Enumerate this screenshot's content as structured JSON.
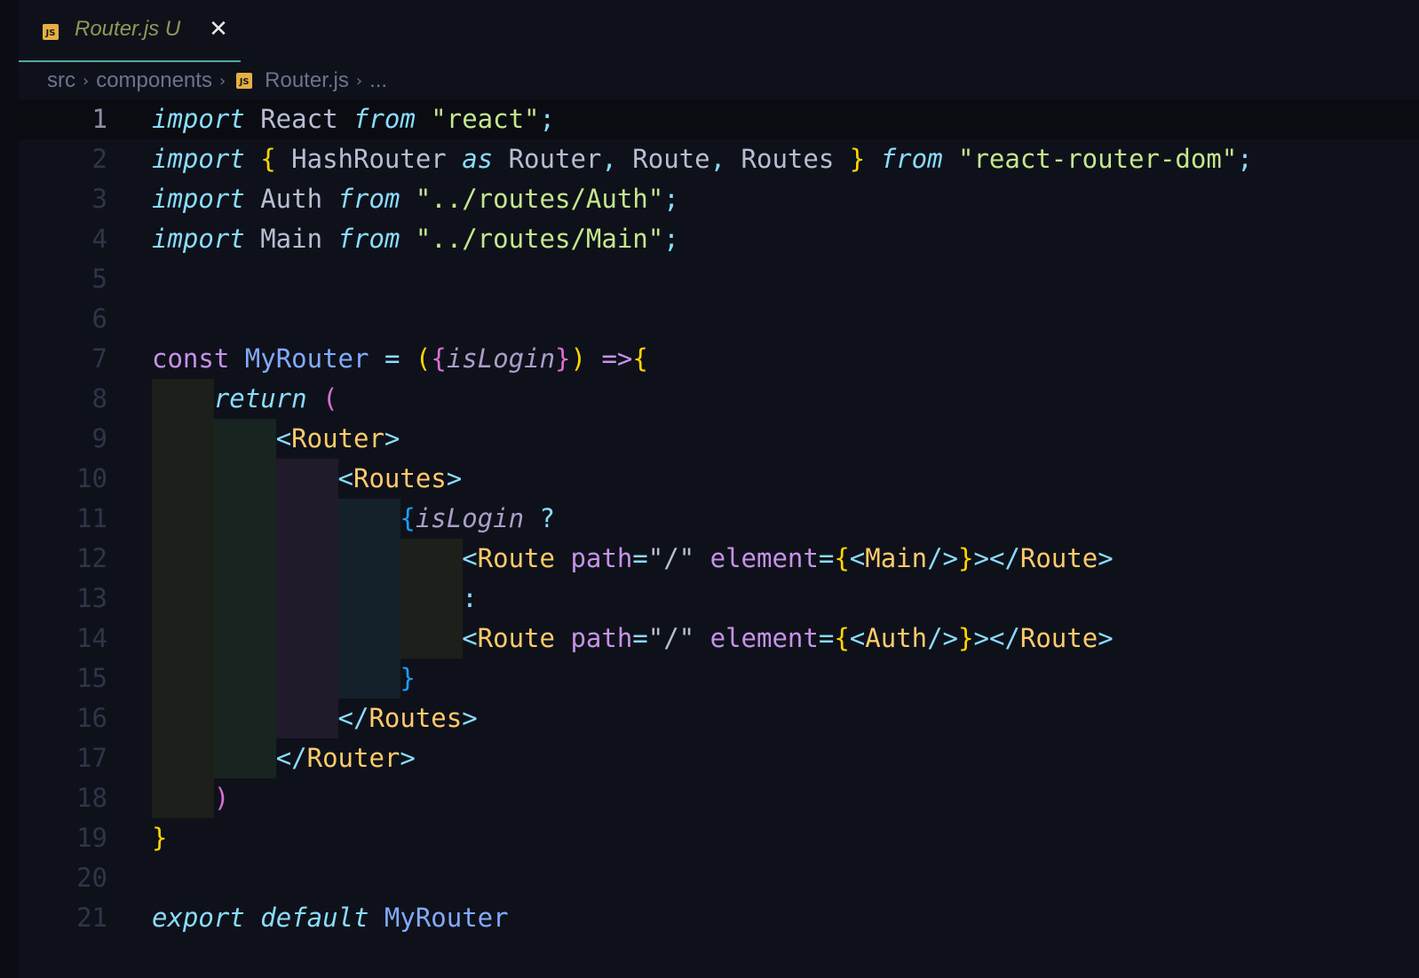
{
  "tab": {
    "icon": "js-file-icon",
    "badge": "JS",
    "title": "Router.js",
    "status": "U",
    "close": "✕"
  },
  "breadcrumb": {
    "items": [
      "src",
      "components",
      "Router.js",
      "..."
    ],
    "separator": "›"
  },
  "active_line": 1,
  "colors": {
    "background": "#0f111a",
    "tab_underline": "#4fa8a0",
    "keyword": "#89ddff",
    "string": "#c3e88d",
    "jsx_tag": "#ffcb6b",
    "attribute": "#c792ea"
  },
  "code_lines": [
    {
      "n": "1",
      "tokens": [
        {
          "t": "import",
          "c": "k-it"
        },
        {
          "t": " React ",
          "c": "ident"
        },
        {
          "t": "from",
          "c": "k-it"
        },
        {
          "t": " ",
          "c": ""
        },
        {
          "t": "\"react\"",
          "c": "str"
        },
        {
          "t": ";",
          "c": "punc"
        }
      ]
    },
    {
      "n": "2",
      "tokens": [
        {
          "t": "import",
          "c": "k-it"
        },
        {
          "t": " ",
          "c": ""
        },
        {
          "t": "{",
          "c": "brace-y"
        },
        {
          "t": " HashRouter ",
          "c": "ident"
        },
        {
          "t": "as",
          "c": "k-it"
        },
        {
          "t": " Router",
          "c": "ident"
        },
        {
          "t": ",",
          "c": "punc"
        },
        {
          "t": " Route",
          "c": "ident"
        },
        {
          "t": ",",
          "c": "punc"
        },
        {
          "t": " Routes ",
          "c": "ident"
        },
        {
          "t": "}",
          "c": "brace-y"
        },
        {
          "t": " ",
          "c": ""
        },
        {
          "t": "from",
          "c": "k-it"
        },
        {
          "t": " ",
          "c": ""
        },
        {
          "t": "\"react-router-dom\"",
          "c": "str"
        },
        {
          "t": ";",
          "c": "punc"
        }
      ]
    },
    {
      "n": "3",
      "tokens": [
        {
          "t": "import",
          "c": "k-it"
        },
        {
          "t": " Auth ",
          "c": "ident"
        },
        {
          "t": "from",
          "c": "k-it"
        },
        {
          "t": " ",
          "c": ""
        },
        {
          "t": "\"../routes/Auth\"",
          "c": "str"
        },
        {
          "t": ";",
          "c": "punc"
        }
      ]
    },
    {
      "n": "4",
      "tokens": [
        {
          "t": "import",
          "c": "k-it"
        },
        {
          "t": " Main ",
          "c": "ident"
        },
        {
          "t": "from",
          "c": "k-it"
        },
        {
          "t": " ",
          "c": ""
        },
        {
          "t": "\"../routes/Main\"",
          "c": "str"
        },
        {
          "t": ";",
          "c": "punc"
        }
      ]
    },
    {
      "n": "5",
      "tokens": []
    },
    {
      "n": "6",
      "tokens": []
    },
    {
      "n": "7",
      "tokens": [
        {
          "t": "const",
          "c": "k-purple"
        },
        {
          "t": " ",
          "c": ""
        },
        {
          "t": "MyRouter",
          "c": "fn"
        },
        {
          "t": " ",
          "c": ""
        },
        {
          "t": "=",
          "c": "punc"
        },
        {
          "t": " ",
          "c": ""
        },
        {
          "t": "(",
          "c": "brace-y"
        },
        {
          "t": "{",
          "c": "brace-p"
        },
        {
          "t": "isLogin",
          "c": "param"
        },
        {
          "t": "}",
          "c": "brace-p"
        },
        {
          "t": ")",
          "c": "brace-y"
        },
        {
          "t": " ",
          "c": ""
        },
        {
          "t": "=>",
          "c": "k-purple"
        },
        {
          "t": "{",
          "c": "brace-y"
        }
      ]
    },
    {
      "n": "8",
      "tokens": [
        {
          "t": "    ",
          "c": ""
        },
        {
          "t": "return",
          "c": "k-it"
        },
        {
          "t": " ",
          "c": ""
        },
        {
          "t": "(",
          "c": "brace-p"
        }
      ]
    },
    {
      "n": "9",
      "tokens": [
        {
          "t": "        ",
          "c": ""
        },
        {
          "t": "<",
          "c": "punc"
        },
        {
          "t": "Router",
          "c": "tag"
        },
        {
          "t": ">",
          "c": "punc"
        }
      ]
    },
    {
      "n": "10",
      "tokens": [
        {
          "t": "            ",
          "c": ""
        },
        {
          "t": "<",
          "c": "punc"
        },
        {
          "t": "Routes",
          "c": "tag"
        },
        {
          "t": ">",
          "c": "punc"
        }
      ]
    },
    {
      "n": "11",
      "tokens": [
        {
          "t": "                ",
          "c": ""
        },
        {
          "t": "{",
          "c": "brace-b"
        },
        {
          "t": "isLogin",
          "c": "param"
        },
        {
          "t": " ",
          "c": ""
        },
        {
          "t": "?",
          "c": "punc"
        }
      ]
    },
    {
      "n": "12",
      "tokens": [
        {
          "t": "                    ",
          "c": ""
        },
        {
          "t": "<",
          "c": "punc"
        },
        {
          "t": "Route",
          "c": "tag"
        },
        {
          "t": " ",
          "c": ""
        },
        {
          "t": "path",
          "c": "attr"
        },
        {
          "t": "=",
          "c": "punc"
        },
        {
          "t": "\"/\"",
          "c": "ident"
        },
        {
          "t": " ",
          "c": ""
        },
        {
          "t": "element",
          "c": "attr"
        },
        {
          "t": "=",
          "c": "punc"
        },
        {
          "t": "{",
          "c": "brace-y"
        },
        {
          "t": "<",
          "c": "punc"
        },
        {
          "t": "Main",
          "c": "tag"
        },
        {
          "t": "/>",
          "c": "punc"
        },
        {
          "t": "}",
          "c": "brace-y"
        },
        {
          "t": "></",
          "c": "punc"
        },
        {
          "t": "Route",
          "c": "tag"
        },
        {
          "t": ">",
          "c": "punc"
        }
      ]
    },
    {
      "n": "13",
      "tokens": [
        {
          "t": "                    ",
          "c": ""
        },
        {
          "t": ":",
          "c": "punc"
        }
      ]
    },
    {
      "n": "14",
      "tokens": [
        {
          "t": "                    ",
          "c": ""
        },
        {
          "t": "<",
          "c": "punc"
        },
        {
          "t": "Route",
          "c": "tag"
        },
        {
          "t": " ",
          "c": ""
        },
        {
          "t": "path",
          "c": "attr"
        },
        {
          "t": "=",
          "c": "punc"
        },
        {
          "t": "\"/\"",
          "c": "ident"
        },
        {
          "t": " ",
          "c": ""
        },
        {
          "t": "element",
          "c": "attr"
        },
        {
          "t": "=",
          "c": "punc"
        },
        {
          "t": "{",
          "c": "brace-y"
        },
        {
          "t": "<",
          "c": "punc"
        },
        {
          "t": "Auth",
          "c": "tag"
        },
        {
          "t": "/>",
          "c": "punc"
        },
        {
          "t": "}",
          "c": "brace-y"
        },
        {
          "t": "></",
          "c": "punc"
        },
        {
          "t": "Route",
          "c": "tag"
        },
        {
          "t": ">",
          "c": "punc"
        }
      ]
    },
    {
      "n": "15",
      "tokens": [
        {
          "t": "                ",
          "c": ""
        },
        {
          "t": "}",
          "c": "brace-b"
        }
      ]
    },
    {
      "n": "16",
      "tokens": [
        {
          "t": "            ",
          "c": ""
        },
        {
          "t": "</",
          "c": "punc"
        },
        {
          "t": "Routes",
          "c": "tag"
        },
        {
          "t": ">",
          "c": "punc"
        }
      ]
    },
    {
      "n": "17",
      "tokens": [
        {
          "t": "        ",
          "c": ""
        },
        {
          "t": "</",
          "c": "punc"
        },
        {
          "t": "Router",
          "c": "tag"
        },
        {
          "t": ">",
          "c": "punc"
        }
      ]
    },
    {
      "n": "18",
      "tokens": [
        {
          "t": "    ",
          "c": ""
        },
        {
          "t": ")",
          "c": "brace-p"
        }
      ]
    },
    {
      "n": "19",
      "tokens": [
        {
          "t": "}",
          "c": "brace-y"
        }
      ]
    },
    {
      "n": "20",
      "tokens": []
    },
    {
      "n": "21",
      "tokens": [
        {
          "t": "export",
          "c": "k-it"
        },
        {
          "t": " ",
          "c": ""
        },
        {
          "t": "default",
          "c": "k-it"
        },
        {
          "t": " ",
          "c": ""
        },
        {
          "t": "MyRouter",
          "c": "fn"
        }
      ]
    }
  ]
}
